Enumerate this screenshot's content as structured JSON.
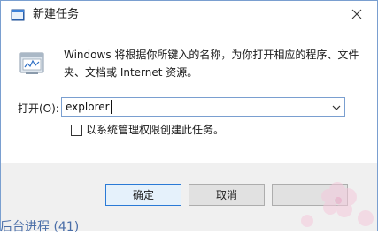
{
  "window": {
    "title": "新建任务",
    "close_icon": "close-icon"
  },
  "body": {
    "description": "Windows 将根据你所键入的名称，为你打开相应的程序、文件夹、文档或 Internet 资源。",
    "open_label": "打开(O):",
    "input_value": "explorer",
    "admin_checkbox_label": "以系统管理权限创建此任务。",
    "admin_checked": false
  },
  "buttons": {
    "ok": "确定",
    "cancel": "取消",
    "browse": ""
  },
  "background": {
    "behind_text": "后台进程 (41)"
  },
  "colors": {
    "accent": "#2a7ad6",
    "border": "#7a9fd0",
    "footer_bg": "#f0f0f0"
  }
}
